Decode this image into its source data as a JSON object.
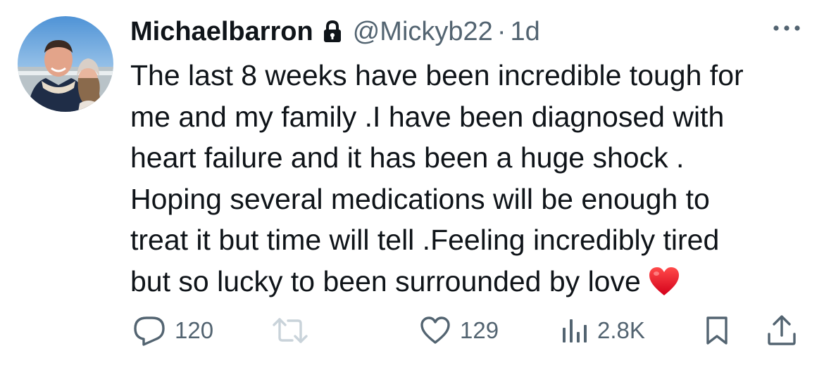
{
  "author": {
    "display_name": "Michaelbarron",
    "handle": "@Mickyb22",
    "separator": "·",
    "time_ago": "1d",
    "protected": true
  },
  "tweet": {
    "lines": [
      "The last 8 weeks have been incredible tough for",
      "me and my family .I have been diagnosed with",
      "heart failure and it has been a huge shock .",
      "Hoping several medications will be enough to",
      "treat it but time will tell .Feeling incredibly tired",
      "but so lucky to been surrounded by love"
    ],
    "trailing_emoji": "red-heart-emoji"
  },
  "actions": {
    "replies": "120",
    "retweets": "",
    "likes": "129",
    "views": "2.8K"
  },
  "icons": {
    "reply": "speech-bubble-icon",
    "retweet": "retweet-icon",
    "like": "heart-outline-icon",
    "views": "bar-chart-icon",
    "bookmark": "bookmark-icon",
    "share": "share-icon",
    "more": "more-horizontal-icon",
    "lock": "lock-icon"
  },
  "colors": {
    "text_primary": "#0f1419",
    "text_secondary": "#536471",
    "heart_emoji": "#e0001b"
  }
}
